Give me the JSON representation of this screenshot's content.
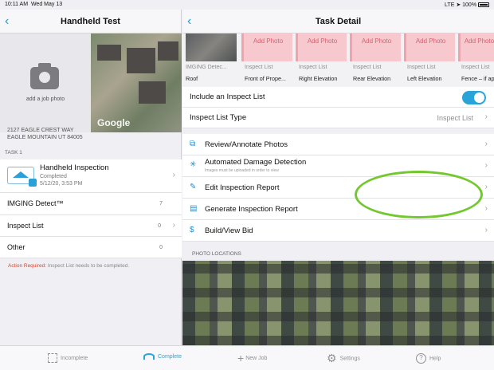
{
  "status": {
    "time": "10:11 AM",
    "date": "Wed May 13",
    "signal": "LTE",
    "battery": "100%"
  },
  "left": {
    "title": "Handheld Test",
    "add_photo": "add a job photo",
    "map_brand": "Google",
    "address_line1": "2127 EAGLE CREST WAY",
    "address_line2": "EAGLE MOUNTAIN UT 84005",
    "section_task": "TASK 1",
    "task": {
      "title": "Handheld Inspection",
      "status": "Completed",
      "date": "5/12/20, 3:53 PM"
    },
    "rows": [
      {
        "label": "IMGING Detect™",
        "count": "7"
      },
      {
        "label": "Inspect List",
        "count": "0"
      },
      {
        "label": "Other",
        "count": "0"
      }
    ],
    "alert_prefix": "Action Required:",
    "alert_text": " Inspect List needs to be completed."
  },
  "right": {
    "title": "Task Detail",
    "photos": [
      {
        "caption1": "IMGING Detec...",
        "caption2": "Roof",
        "type": "image"
      },
      {
        "caption1": "Inspect List",
        "caption2": "Front of Prope...",
        "type": "add"
      },
      {
        "caption1": "Inspect List",
        "caption2": "Right Elevation",
        "type": "add"
      },
      {
        "caption1": "Inspect List",
        "caption2": "Rear Elevation",
        "type": "add"
      },
      {
        "caption1": "Inspect List",
        "caption2": "Left Elevation",
        "type": "add"
      },
      {
        "caption1": "Inspect List",
        "caption2": "Fence – if ap",
        "type": "add"
      }
    ],
    "add_photo_label": "Add Photo",
    "include_label": "Include an Inspect List",
    "include_on": true,
    "list_type_label": "Inspect List Type",
    "list_type_value": "Inspect List",
    "menu": [
      {
        "label": "Review/Annotate Photos",
        "icon": "photo-icon"
      },
      {
        "label": "Automated Damage Detection",
        "icon": "detect-icon",
        "sub": "Images must be uploaded in order to view"
      },
      {
        "label": "Edit Inspection Report",
        "icon": "edit-icon"
      },
      {
        "label": "Generate Inspection Report",
        "icon": "report-icon"
      },
      {
        "label": "Build/View Bid",
        "icon": "bid-icon"
      }
    ],
    "photo_locations": "PHOTO LOCATIONS"
  },
  "tabs": [
    {
      "label": "Incomplete",
      "icon": "incomplete-icon"
    },
    {
      "label": "Complete",
      "icon": "complete-icon",
      "active": true
    },
    {
      "label": "New Job",
      "icon": "plus-icon"
    },
    {
      "label": "Settings",
      "icon": "gear-icon"
    },
    {
      "label": "Help",
      "icon": "help-icon"
    }
  ],
  "colors": {
    "accent": "#2aa3d8",
    "alert": "#d8452f",
    "highlight": "#74c82f",
    "add_photo_bg": "#f7c9cf"
  }
}
